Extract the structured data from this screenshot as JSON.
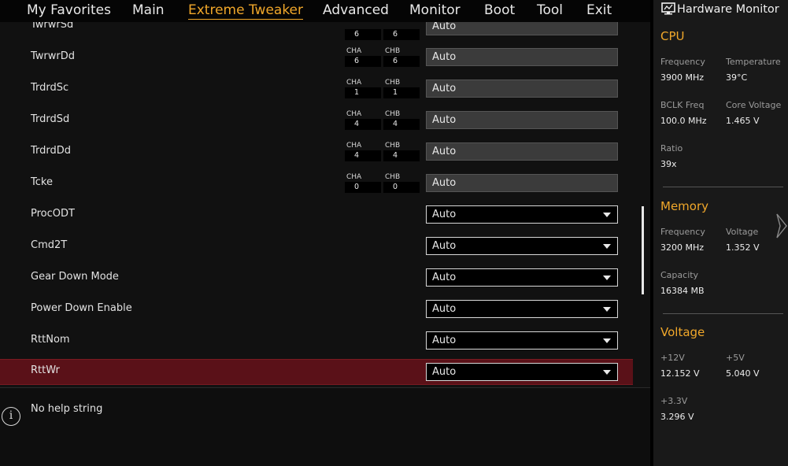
{
  "nav": {
    "tabs": [
      {
        "label": "My Favorites"
      },
      {
        "label": "Main"
      },
      {
        "label": "Extreme Tweaker",
        "active": true
      },
      {
        "label": "Advanced"
      },
      {
        "label": "Monitor"
      },
      {
        "label": "Boot"
      },
      {
        "label": "Tool"
      },
      {
        "label": "Exit"
      }
    ]
  },
  "settings": {
    "partial_row": {
      "label": "TwrwrSd",
      "cha": "6",
      "chb": "6",
      "value": "Auto"
    },
    "rows": [
      {
        "label": "TwrwrDd",
        "cha_label": "CHA",
        "cha": "6",
        "chb_label": "CHB",
        "chb": "6",
        "value": "Auto"
      },
      {
        "label": "TrdrdSc",
        "cha_label": "CHA",
        "cha": "1",
        "chb_label": "CHB",
        "chb": "1",
        "value": "Auto"
      },
      {
        "label": "TrdrdSd",
        "cha_label": "CHA",
        "cha": "4",
        "chb_label": "CHB",
        "chb": "4",
        "value": "Auto"
      },
      {
        "label": "TrdrdDd",
        "cha_label": "CHA",
        "cha": "4",
        "chb_label": "CHB",
        "chb": "4",
        "value": "Auto"
      },
      {
        "label": "Tcke",
        "cha_label": "CHA",
        "cha": "0",
        "chb_label": "CHB",
        "chb": "0",
        "value": "Auto"
      },
      {
        "label": "ProcODT",
        "value": "Auto"
      },
      {
        "label": "Cmd2T",
        "value": "Auto"
      },
      {
        "label": "Gear Down Mode",
        "value": "Auto"
      },
      {
        "label": "Power Down Enable",
        "value": "Auto"
      },
      {
        "label": "RttNom",
        "value": "Auto"
      },
      {
        "label": "RttWr",
        "value": "Auto"
      }
    ]
  },
  "help": {
    "text": "No help string",
    "icon": "info-icon"
  },
  "hw_monitor": {
    "title": "Hardware Monitor",
    "icon": "monitor-icon",
    "cpu": {
      "section": "CPU",
      "frequency_label": "Frequency",
      "frequency": "3900 MHz",
      "temperature_label": "Temperature",
      "temperature": "39°C",
      "bclk_label": "BCLK Freq",
      "bclk": "100.0 MHz",
      "core_voltage_label": "Core Voltage",
      "core_voltage": "1.465 V",
      "ratio_label": "Ratio",
      "ratio": "39x"
    },
    "memory": {
      "section": "Memory",
      "frequency_label": "Frequency",
      "frequency": "3200 MHz",
      "voltage_label": "Voltage",
      "voltage": "1.352 V",
      "capacity_label": "Capacity",
      "capacity": "16384 MB"
    },
    "voltage": {
      "section": "Voltage",
      "v12_label": "+12V",
      "v12": "12.152 V",
      "v5_label": "+5V",
      "v5": "5.040 V",
      "v33_label": "+3.3V",
      "v33": "3.296 V"
    }
  },
  "colors": {
    "accent": "#f0a72a",
    "selected_row": "#5a1118",
    "panel": "#191919",
    "background": "#111111"
  }
}
